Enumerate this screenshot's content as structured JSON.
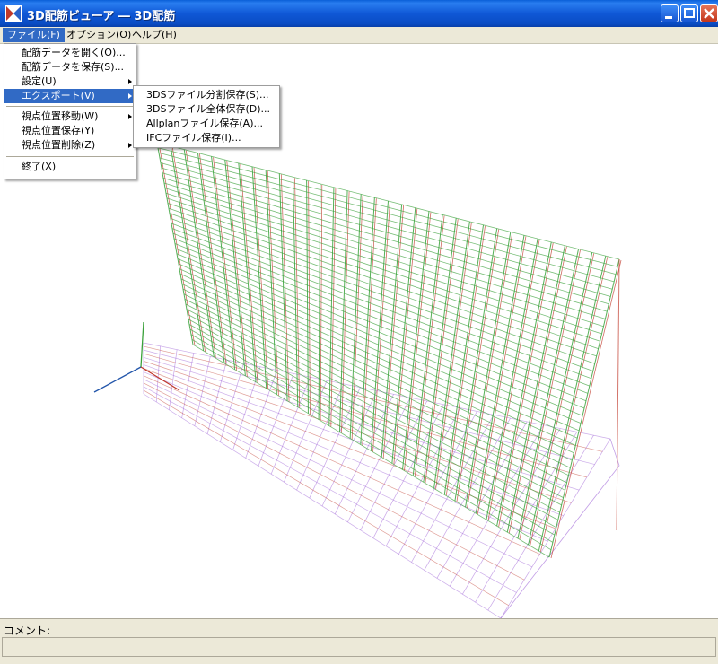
{
  "window": {
    "title": "3D配筋ビューア ― 3D配筋"
  },
  "menubar": {
    "items": [
      "ファイル(F)",
      "オプション(O)",
      "ヘルプ(H)"
    ]
  },
  "file_menu": {
    "items": [
      "配筋データを開く(O)...",
      "配筋データを保存(S)...",
      "設定(U)",
      "エクスポート(V)",
      "視点位置移動(W)",
      "視点位置保存(Y)",
      "視点位置削除(Z)",
      "終了(X)"
    ]
  },
  "export_submenu": {
    "items": [
      "3DSファイル分割保存(S)...",
      "3DSファイル全体保存(D)...",
      "Allplanファイル保存(A)...",
      "IFCファイル保存(I)..."
    ]
  },
  "status": {
    "comment_label": "コメント:",
    "comment_value": ""
  },
  "colors": {
    "titlebar": "#0a5fd8",
    "menu_highlight": "#316ac5",
    "rebar_red": "#c0392b",
    "rebar_green": "#3aa13a",
    "footing_purple": "#9a5bd6",
    "axis_blue": "#2255aa"
  }
}
